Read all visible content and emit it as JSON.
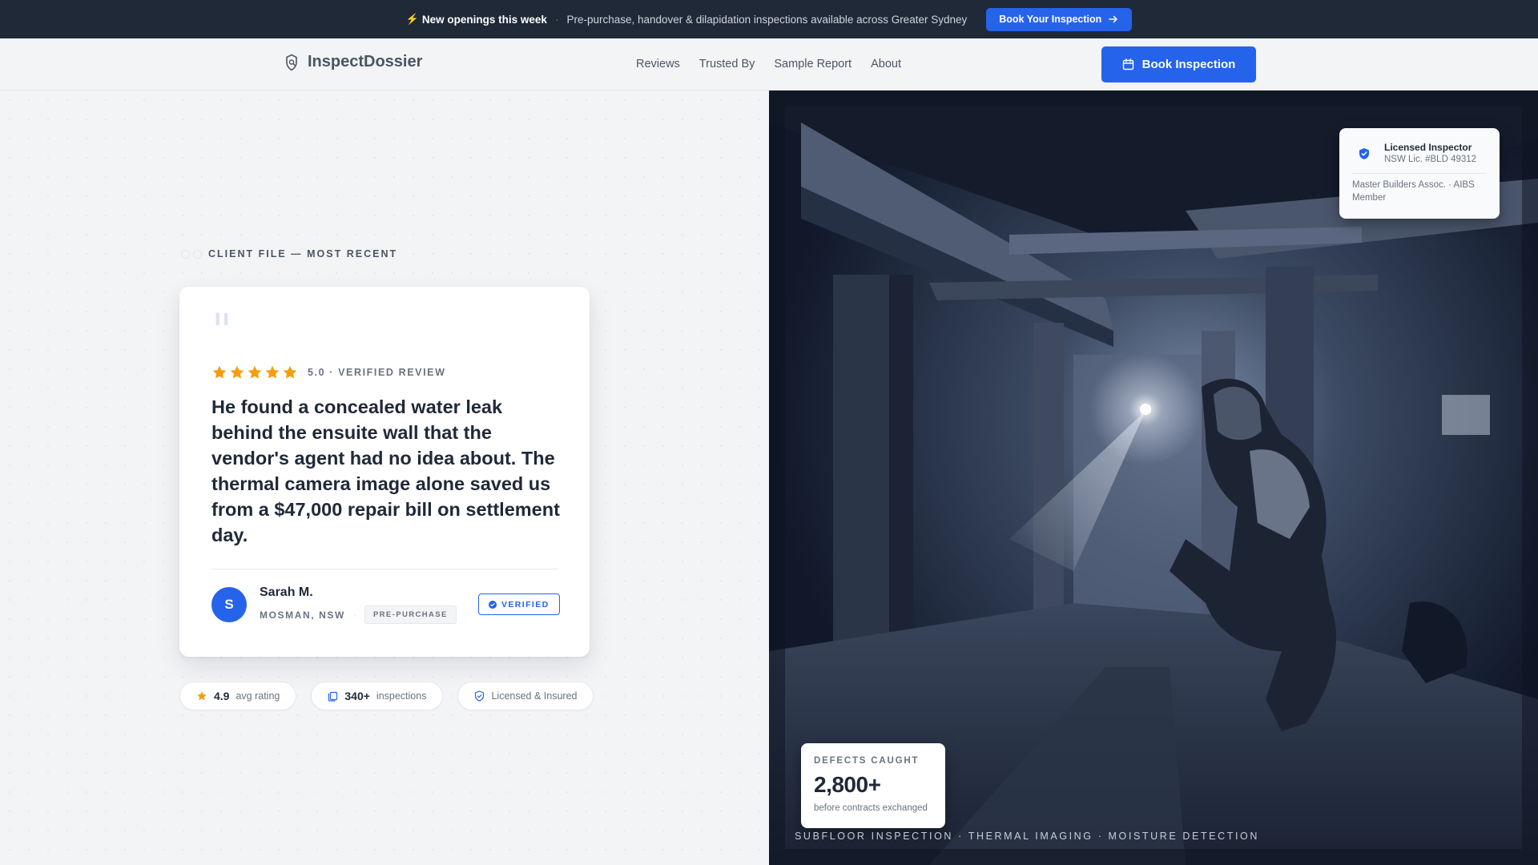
{
  "announcement": {
    "headline": "New openings this week",
    "message": "Pre-purchase, handover & dilapidation inspections available across Greater Sydney",
    "cta_label": "Book Your Inspection"
  },
  "nav": {
    "brand": "InspectDossier",
    "links": [
      "Reviews",
      "Trusted By",
      "Sample Report",
      "About"
    ],
    "cta_label": "Book Inspection"
  },
  "hero": {
    "eyebrow": "CLIENT FILE — MOST RECENT",
    "review": {
      "rating": 5,
      "rating_label": "5.0 · VERIFIED REVIEW",
      "quote": "He found a concealed water leak behind the ensuite wall that the vendor's agent had no idea about. The thermal camera image alone saved us from a $47,000 repair bill on settlement day.",
      "author_initial": "S",
      "author_name": "Sarah M.",
      "author_location": "MOSMAN, NSW",
      "separator": "·",
      "inspection_type": "PRE-PURCHASE",
      "verified_label": "VERIFIED"
    },
    "stats": [
      {
        "value": "4.9",
        "label": "avg rating"
      },
      {
        "value": "340+",
        "label": "inspections"
      },
      {
        "value": "",
        "label": "Licensed & Insured"
      }
    ]
  },
  "photo": {
    "license_card": {
      "title": "Licensed Inspector",
      "license_number": "NSW Lic. #BLD 49312",
      "associations": "Master Builders Assoc. · AIBS Member"
    },
    "defects_card": {
      "label": "DEFECTS CAUGHT",
      "value": "2,800+",
      "sublabel": "before contracts exchanged"
    },
    "caption": "SUBFLOOR INSPECTION · THERMAL IMAGING · MOISTURE DETECTION"
  },
  "colors": {
    "accent": "#2563eb",
    "dark_bar": "#1f2937",
    "star": "#f59e0b",
    "page_bg": "#f3f4f6"
  }
}
